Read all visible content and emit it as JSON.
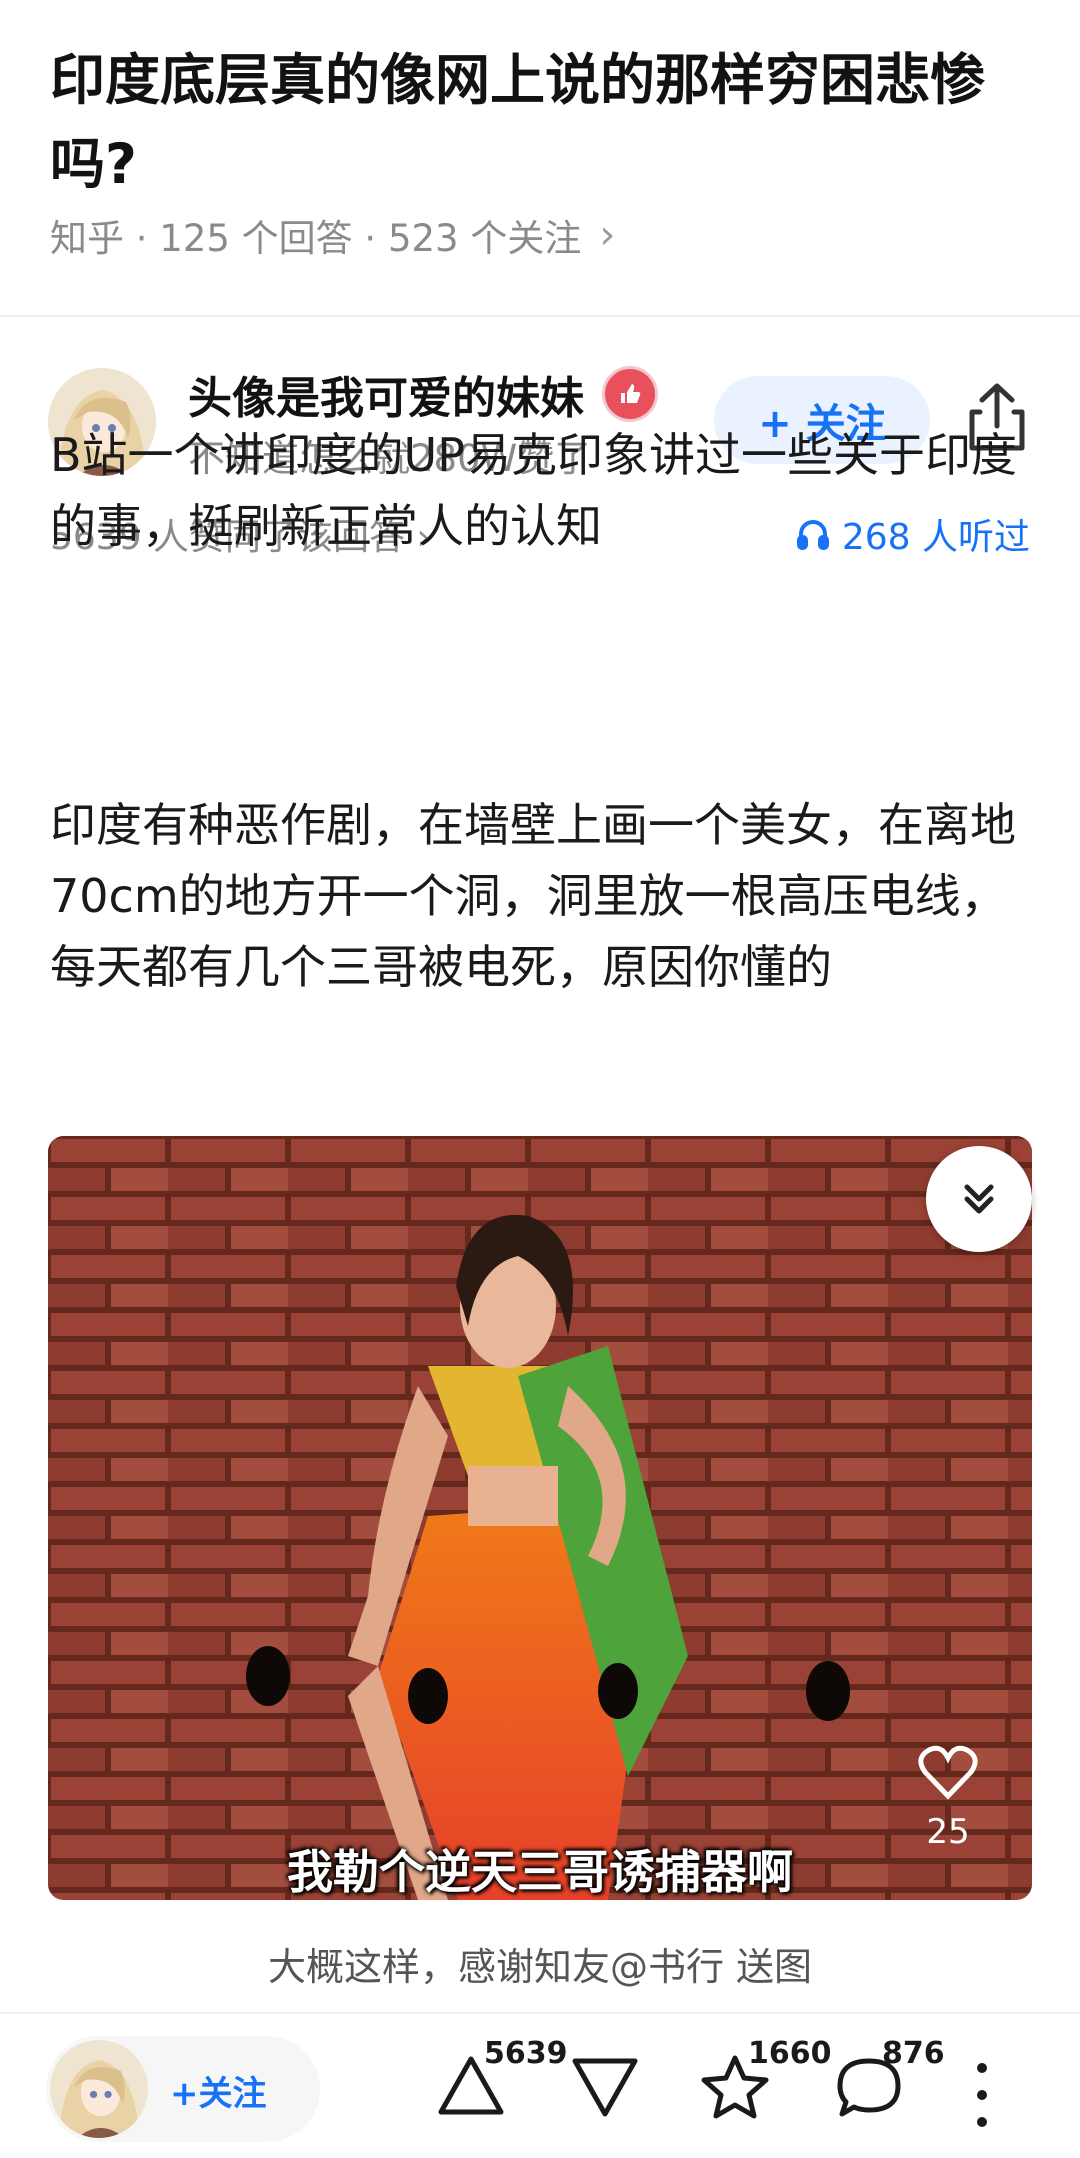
{
  "question": {
    "title": "印度底层真的像网上说的那样穷困悲惨吗?",
    "meta": "知乎 · 125 个回答 · 523 个关注",
    "chevron": "›"
  },
  "author": {
    "name": "头像是我可爱的妹妹",
    "subtitle": "不知道怎么就280W赞了",
    "follow_label": "+ 关注"
  },
  "stats": {
    "agree_text": "5639 人赞同了该回答 ›",
    "listen_text": "268 人听过"
  },
  "answer": {
    "paragraphs": [
      "B站一个讲印度的UP易克印象讲过一些关于印度的事，挺刷新正常人的认知",
      "印度有种恶作剧，在墙壁上画一个美女，在离地70cm的地方开一个洞，洞里放一根高压电线，每天都有几个三哥被电死，原因你懂的"
    ],
    "image_subtitle": "我勒个逆天三哥诱捕器啊",
    "image_like_count": "25",
    "caption": "大概这样，感谢知友@书行 送图"
  },
  "bottom_bar": {
    "follow_label": "+关注",
    "upvote_count": "5639",
    "favorite_count": "1660",
    "comment_count": "876"
  },
  "colors": {
    "accent": "#1772f6",
    "follow_bg": "#ebf2ff",
    "meta_gray": "#8a8a8a"
  },
  "icons": [
    "chevron-right-icon",
    "verified-badge-icon",
    "share-icon",
    "headphones-icon",
    "collapse-chevron-icon",
    "heart-icon",
    "upvote-icon",
    "downvote-icon",
    "star-icon",
    "comment-icon",
    "more-icon"
  ]
}
